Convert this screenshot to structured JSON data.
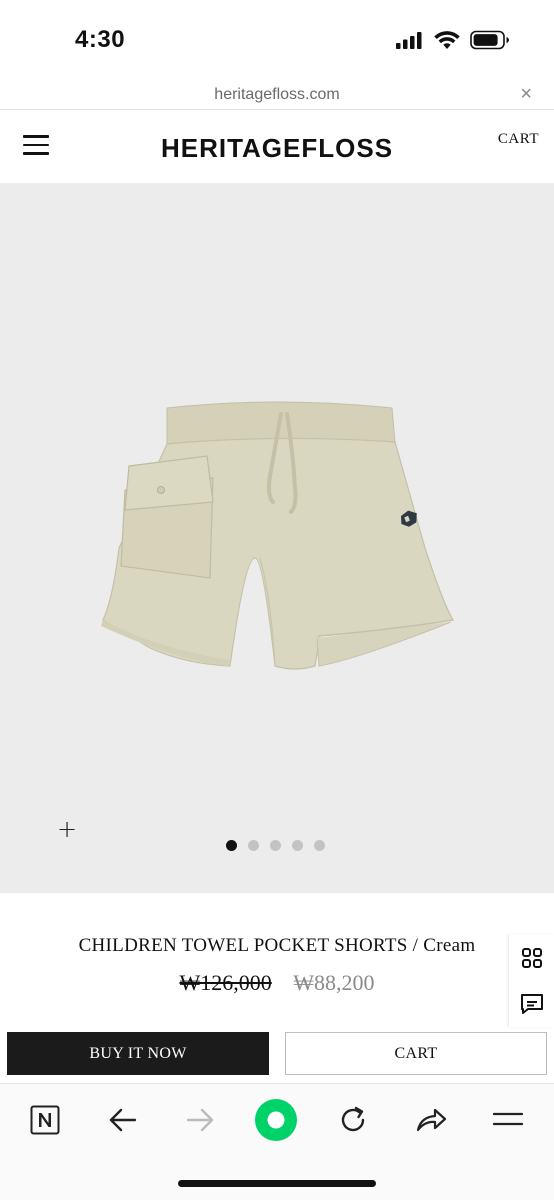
{
  "status_bar": {
    "time": "4:30"
  },
  "browser": {
    "url": "heritagefloss.com",
    "close_glyph": "×"
  },
  "site": {
    "brand": "HERITAGEFLOSS",
    "cart_label": "CART"
  },
  "gallery": {
    "zoom_glyph": "+",
    "dot_count": 5,
    "active_index": 0,
    "background": "#ececec"
  },
  "product": {
    "title": "CHILDREN TOWEL POCKET SHORTS / Cream",
    "original_price": "₩126,000",
    "sale_price": "₩88,200",
    "color": "#d9d7c0"
  },
  "actions": {
    "buy_label": "BUY IT NOW",
    "cart_label": "CART"
  },
  "side_tools": [
    "grid-icon",
    "chat-icon"
  ],
  "toolbar_icons": [
    "naver-icon",
    "back-arrow-icon",
    "forward-arrow-icon",
    "green-dot-icon",
    "reload-icon",
    "share-icon",
    "menu-icon"
  ],
  "colors": {
    "accent_green": "#00d26a",
    "buy_button": "#1b1b1b"
  }
}
